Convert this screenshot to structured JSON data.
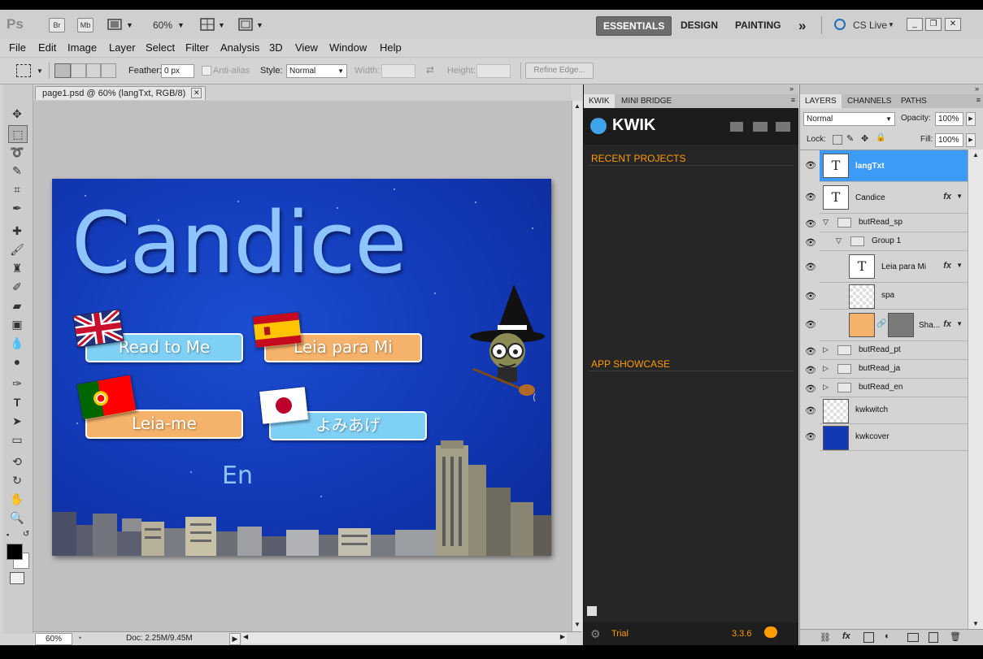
{
  "app": {
    "logo": "Ps",
    "bridge": "Br",
    "minibridge": "Mb",
    "zoom": "60%",
    "workspaces": [
      "ESSENTIALS",
      "DESIGN",
      "PAINTING"
    ],
    "more": "»",
    "cslive": "CS Live"
  },
  "menu": [
    "File",
    "Edit",
    "Image",
    "Layer",
    "Select",
    "Filter",
    "Analysis",
    "3D",
    "View",
    "Window",
    "Help"
  ],
  "options": {
    "feather_label": "Feather:",
    "feather_value": "0 px",
    "antialias_label": "Anti-alias",
    "style_label": "Style:",
    "style_value": "Normal",
    "width_label": "Width:",
    "height_label": "Height:",
    "refine_edge": "Refine Edge..."
  },
  "document": {
    "tab_title": "page1.psd @ 60% (langTxt, RGB/8)",
    "status_zoom": "60%",
    "status_doc": "Doc: 2.25M/9.45M"
  },
  "artwork": {
    "title": "Candice",
    "buttons": {
      "en": "Read to Me",
      "sp": "Leia para Mi",
      "pt": "Leia-me",
      "ja": "よみあげ"
    },
    "lang_text": "En"
  },
  "kwik": {
    "tabs": [
      "KWIK",
      "MINI BRIDGE"
    ],
    "brand": "KWIK",
    "recent": "RECENT PROJECTS",
    "showcase": "APP SHOWCASE",
    "trial": "Trial",
    "version": "3.3.6"
  },
  "layers": {
    "tabs": [
      "LAYERS",
      "CHANNELS",
      "PATHS"
    ],
    "blend": "Normal",
    "opacity_label": "Opacity:",
    "opacity": "100%",
    "lock_label": "Lock:",
    "fill_label": "Fill:",
    "fill": "100%",
    "items": [
      {
        "name": "langTxt"
      },
      {
        "name": "Candice"
      },
      {
        "name": "butRead_sp"
      },
      {
        "name": "Group 1"
      },
      {
        "name": "Leia para Mi"
      },
      {
        "name": "spa"
      },
      {
        "name": "Sha..."
      },
      {
        "name": "butRead_pt"
      },
      {
        "name": "butRead_ja"
      },
      {
        "name": "butRead_en"
      },
      {
        "name": "kwkwitch"
      },
      {
        "name": "kwkcover"
      }
    ]
  },
  "colors": {
    "accent_orange": "#ff9c00",
    "selected_layer": "#3b9bf7",
    "button_blue": "#7fd0f5",
    "button_orange": "#f5b26a"
  }
}
